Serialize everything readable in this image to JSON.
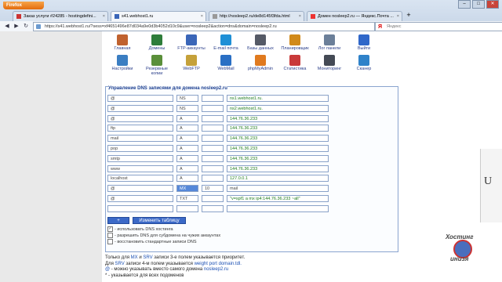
{
  "browser": {
    "brand": "Firefox",
    "tabs": [
      {
        "label": "Заказ услуги #24285 - hostingdefini...",
        "active": false
      },
      {
        "label": "s41.webhost1.ru",
        "active": true
      },
      {
        "label": "http://nosleep2.ru/de8d145f3fda.html",
        "active": false
      },
      {
        "label": "Домен nosleep2.ru — Яндекс.Почта ...",
        "active": false
      }
    ],
    "url": "https://s41.webhost1.ru/?sess=xf4651496e87d034a9e0d3b4052d10c9&user=nosleep2&action=dns&domain=nosleep2.ru",
    "search_placeholder": "Яндекс",
    "new_tab": "+",
    "window_buttons": [
      "–",
      "□",
      "✕"
    ]
  },
  "toolbar": {
    "row1": [
      {
        "label": "Главная",
        "icon": "home-icon",
        "color": "#c0622f"
      },
      {
        "label": "Домены",
        "icon": "globe-icon",
        "color": "#2e7d3a"
      },
      {
        "label": "FTP-аккаунты",
        "icon": "ftp-icon",
        "color": "#3a66b8"
      },
      {
        "label": "E-mail почта",
        "icon": "mail-icon",
        "color": "#1e8fd6"
      },
      {
        "label": "Базы данных",
        "icon": "database-icon",
        "color": "#555a66"
      },
      {
        "label": "Планировщик",
        "icon": "scheduler-icon",
        "color": "#d18a1a"
      },
      {
        "label": "Лог панели",
        "icon": "log-icon",
        "color": "#6b7f99"
      },
      {
        "label": "Выйти",
        "icon": "power-icon",
        "color": "#2f67c9"
      }
    ],
    "row2": [
      {
        "label": "Настройки",
        "icon": "settings-icon",
        "color": "#3b7ec2"
      },
      {
        "label": "Резервные копии",
        "icon": "backup-icon",
        "color": "#5a8f3a"
      },
      {
        "label": "WebFTP",
        "icon": "webftp-icon",
        "color": "#c5a13a"
      },
      {
        "label": "WebMail",
        "icon": "webmail-icon",
        "color": "#2a6fc4"
      },
      {
        "label": "phpMyAdmin",
        "icon": "phpmyadmin-icon",
        "color": "#e07a1f"
      },
      {
        "label": "Статистика",
        "icon": "stats-icon",
        "color": "#c93a3a"
      },
      {
        "label": "Мониторинг",
        "icon": "monitor-icon",
        "color": "#444a55"
      },
      {
        "label": "Сканер",
        "icon": "scanner-icon",
        "color": "#2f82c9"
      }
    ]
  },
  "dns": {
    "title": "Управление DNS записями для домена nosleep2.ru",
    "records": [
      {
        "host": "@",
        "type": "NS",
        "prio": "",
        "value": "ns1.webhost1.ru."
      },
      {
        "host": "@",
        "type": "NS",
        "prio": "",
        "value": "ns2.webhost1.ru."
      },
      {
        "host": "@",
        "type": "A",
        "prio": "",
        "value": "144.76.36.233"
      },
      {
        "host": "ftp",
        "type": "A",
        "prio": "",
        "value": "144.76.36.233"
      },
      {
        "host": "mail",
        "type": "A",
        "prio": "",
        "value": "144.76.36.233"
      },
      {
        "host": "pop",
        "type": "A",
        "prio": "",
        "value": "144.76.36.233"
      },
      {
        "host": "smtp",
        "type": "A",
        "prio": "",
        "value": "144.76.36.233"
      },
      {
        "host": "www",
        "type": "A",
        "prio": "",
        "value": "144.76.36.233"
      },
      {
        "host": "localhost",
        "type": "A",
        "prio": "",
        "value": "127.0.0.1"
      },
      {
        "host": "@",
        "type": "MX",
        "prio": "10",
        "value": "mail"
      },
      {
        "host": "@",
        "type": "TXT",
        "prio": "",
        "value": "\"v=spf1 a mx ip4:144.76.36.233 ~all\""
      },
      {
        "host": "",
        "type": "",
        "prio": "",
        "value": ""
      }
    ],
    "add_button": "+",
    "save_button": "Изменить таблицу",
    "checkboxes": [
      {
        "label": "- использовать DNS хостинга",
        "checked": true
      },
      {
        "label": "- разрешить DNS для субдомена на чужих аккаунтах",
        "checked": false
      },
      {
        "label": "- восстановить стандартные записи DNS",
        "checked": false
      }
    ]
  },
  "notes": [
    {
      "parts": [
        {
          "t": "Только для ",
          "c": ""
        },
        {
          "t": "MX",
          "c": "blue"
        },
        {
          "t": " и ",
          "c": ""
        },
        {
          "t": "SRV",
          "c": "blue"
        },
        {
          "t": " записи 3-е полем указывается приоритет.",
          "c": ""
        }
      ]
    },
    {
      "parts": [
        {
          "t": "Для ",
          "c": ""
        },
        {
          "t": "SRV",
          "c": "blue"
        },
        {
          "t": " записи 4-м полем указывается ",
          "c": ""
        },
        {
          "t": "weight port domain.tdl.",
          "c": "blue"
        }
      ]
    },
    {
      "parts": [
        {
          "t": "@",
          "c": "blue"
        },
        {
          "t": " - можно указывать вместо самого домена ",
          "c": ""
        },
        {
          "t": "nosleep2.ru",
          "c": "blue"
        }
      ]
    },
    {
      "parts": [
        {
          "t": "* - указывается для всех подоменов",
          "c": ""
        }
      ]
    }
  ],
  "watermark": {
    "top": "Хостинг",
    "bottom": "инизя"
  },
  "sidepanel_letter": "U"
}
